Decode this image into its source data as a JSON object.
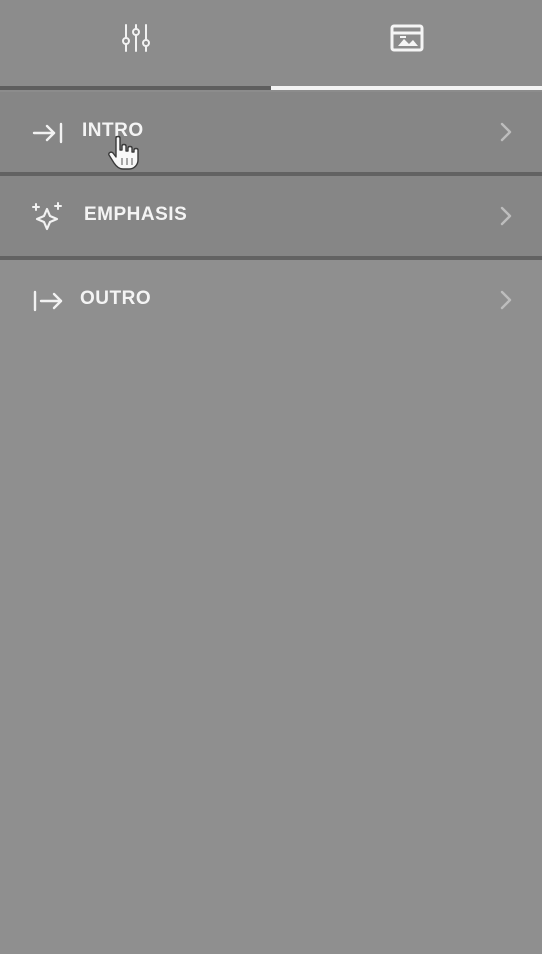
{
  "tabs": [
    {
      "name": "adjust-tab",
      "icon": "sliders-icon",
      "active": false
    },
    {
      "name": "transitions-tab",
      "icon": "transition-image-icon",
      "active": true
    }
  ],
  "items": [
    {
      "label": "INTRO",
      "icon": "arrow-right-to-bar-icon"
    },
    {
      "label": "EMPHASIS",
      "icon": "sparkles-icon"
    },
    {
      "label": "OUTRO",
      "icon": "bar-arrow-right-icon"
    }
  ],
  "colors": {
    "background": "#8f8f8f",
    "row": "#868686",
    "divider": "#626262",
    "active_underline": "#f3f3f3",
    "text": "#f4f4f4"
  }
}
